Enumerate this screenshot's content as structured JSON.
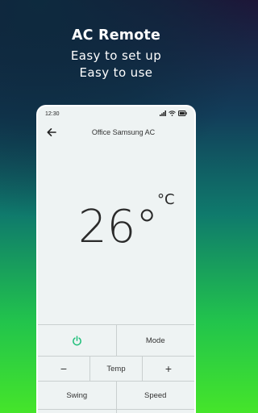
{
  "promo": {
    "title": "AC Remote",
    "line1": "Easy to set up",
    "line2": "Easy to use"
  },
  "status_bar": {
    "time": "12:30",
    "icons": [
      "signal-icon",
      "wifi-icon",
      "battery-icon"
    ]
  },
  "app_bar": {
    "back_icon": "back-arrow-icon",
    "title": "Office Samsung AC"
  },
  "temperature": {
    "value": "26",
    "degree": "°",
    "unit": "°C"
  },
  "controls": {
    "power_icon": "power-icon",
    "power_color": "#1fbf7a",
    "mode_label": "Mode",
    "temp_down_label": "−",
    "temp_label": "Temp",
    "temp_up_label": "+",
    "swing_label": "Swing",
    "speed_label": "Speed"
  }
}
